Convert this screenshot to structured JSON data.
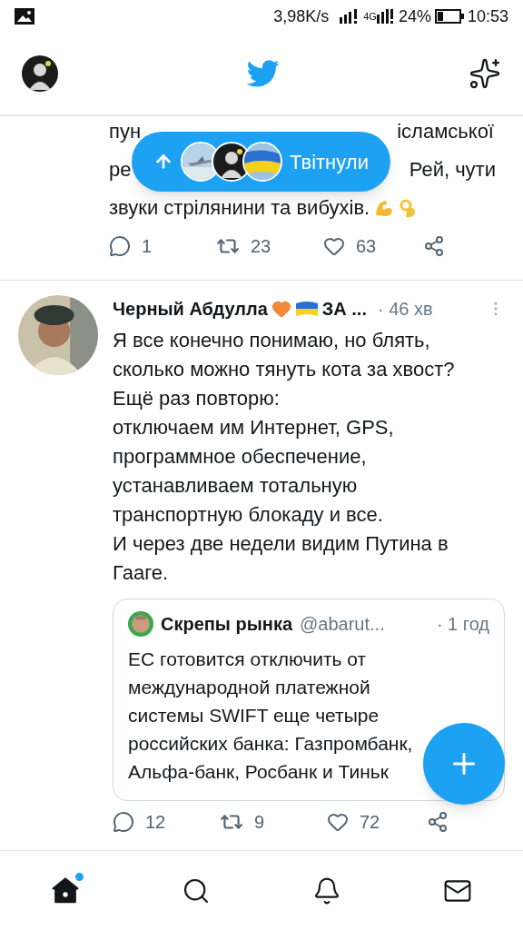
{
  "status_bar": {
    "speed": "3,98K/s",
    "network": "4G",
    "battery": "24%",
    "time": "10:53"
  },
  "new_tweets_pill": {
    "label": "Твітнули"
  },
  "tweets": [
    {
      "kind": "fragment",
      "lines": [
        [
          "пун",
          "ісламської"
        ],
        [
          "ре",
          "Рей, чути"
        ],
        [
          "звуки стрілянини та вибухів."
        ]
      ],
      "actions": {
        "replies": "1",
        "retweets": "23",
        "likes": "63"
      }
    },
    {
      "kind": "full",
      "author": "Черный Абдулла",
      "name_suffix": "ЗА ...",
      "time": "· 46 хв",
      "text": "Я все конечно понимаю, но блять,\nсколько можно тянуть кота за хвост?\nЕщё раз повторю:\nотключаем им Интернет, GPS,\nпрограммное обеспечение,\nустанавливаем тотальную\nтранспортную блокаду и все.\nИ через две недели видим Путина в\nГааге.",
      "quote": {
        "author": "Скрепы рынка",
        "handle": "@abarut...",
        "time": "· 1 год",
        "text": "ЕС готовится отключить от\nмеждународной платежной\nсистемы SWIFT еще четыре\nроссийских банка: Газпромбанк,\nАльфа-банк, Росбанк и Тиньк"
      },
      "actions": {
        "replies": "12",
        "retweets": "9",
        "likes": "72"
      }
    }
  ],
  "bottom_nav": [
    {
      "kind": "home",
      "selected": true,
      "new": true
    },
    {
      "kind": "search",
      "selected": false,
      "new": false
    },
    {
      "kind": "bell",
      "selected": false,
      "new": false
    },
    {
      "kind": "mail",
      "selected": false,
      "new": false
    }
  ]
}
